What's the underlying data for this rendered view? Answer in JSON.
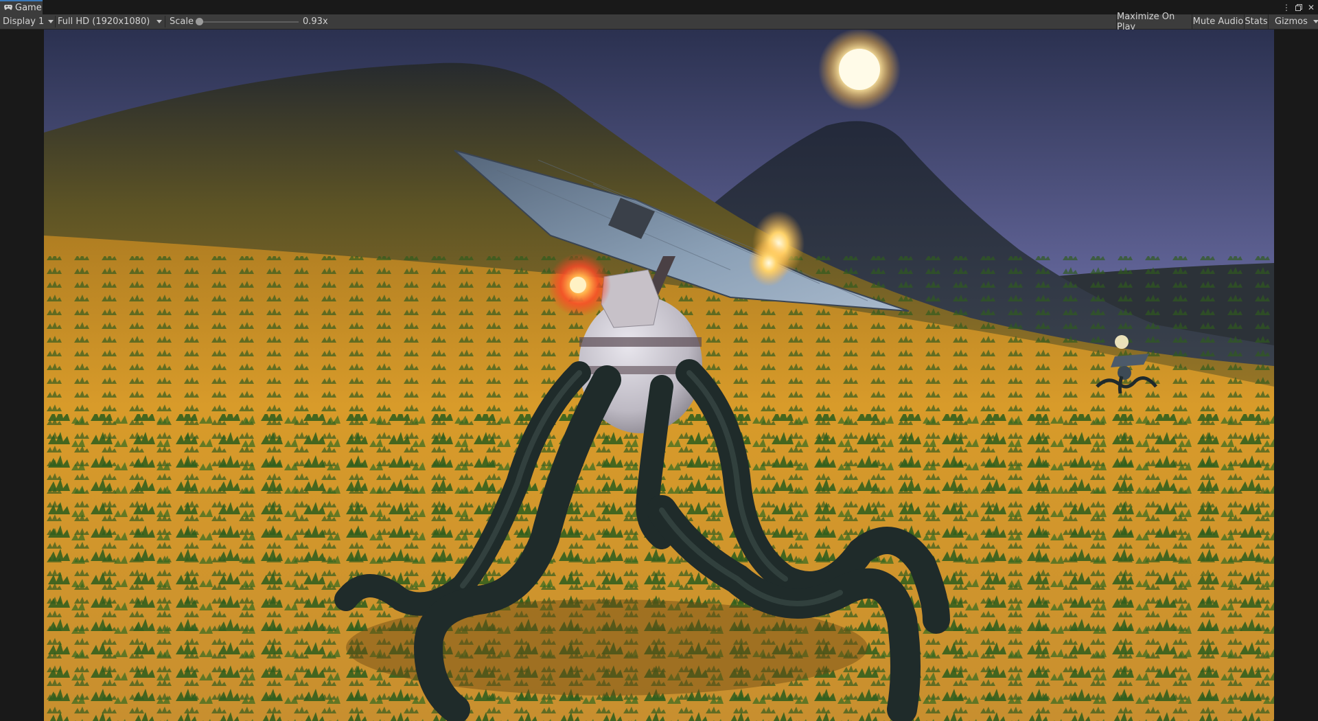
{
  "tab": {
    "label": "Game",
    "icon": "gamepad-icon"
  },
  "window_controls": {
    "more_icon": "kebab-menu-icon",
    "maximize_icon": "maximize-icon",
    "close_icon": "close-icon"
  },
  "toolbar": {
    "display": "Display 1",
    "resolution": "Full HD (1920x1080)",
    "scale_label": "Scale",
    "scale_value": "0.93x",
    "scale_fraction": 0.02,
    "maximize_on_play": "Maximize On Play",
    "mute_audio": "Mute Audio",
    "stats": "Stats",
    "gizmos": "Gizmos"
  },
  "scene": {
    "description_colors": {
      "sky_top": "#2f3553",
      "sky_horizon": "#a9a4d8",
      "ground": "#d69a2a",
      "robot_leg": "#243330",
      "robot_eye": "#ff5a2a"
    }
  }
}
